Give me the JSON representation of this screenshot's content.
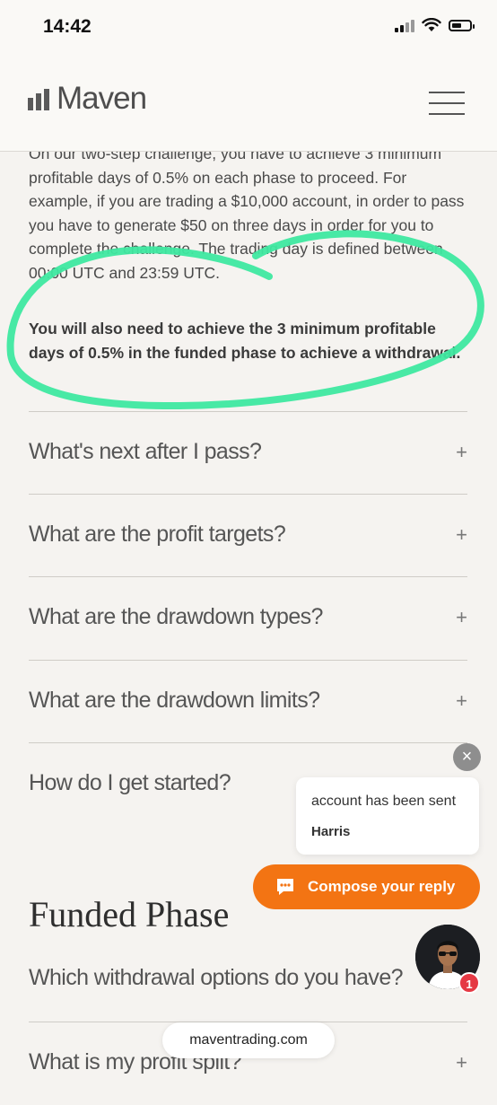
{
  "status_bar": {
    "time": "14:42"
  },
  "brand": {
    "name": "Maven"
  },
  "content": {
    "paragraph": "On our two-step challenge, you have to achieve 3 minimum profitable days of 0.5% on each phase to proceed. For example, if you are trading a $10,000 account, in order to pass you have to generate $50 on three days in order for you to complete the challenge. The trading day is defined between 00:00 UTC and 23:59 UTC.",
    "bold_paragraph": "You will also need to achieve the 3 minimum profitable days of 0.5% in the funded phase to achieve a withdrawal."
  },
  "faq": [
    {
      "question": "What's next after I pass?",
      "icon": "+"
    },
    {
      "question": "What are the profit targets?",
      "icon": "+"
    },
    {
      "question": "What are the drawdown types?",
      "icon": "+"
    },
    {
      "question": "What are the drawdown limits?",
      "icon": "+"
    },
    {
      "question": "How do I get started?",
      "icon": "+"
    }
  ],
  "funded_section": {
    "title": "Funded Phase",
    "faq": [
      {
        "question": "Which withdrawal options do you have?",
        "icon": "+"
      },
      {
        "question": "What is my profit split?",
        "icon": "+"
      }
    ]
  },
  "chat": {
    "close_icon": "×",
    "message": "account has been sent",
    "sender": "Harris",
    "compose_label": "Compose your reply",
    "unread_count": "1"
  },
  "browser": {
    "url": "maventrading.com"
  },
  "colors": {
    "accent": "#f37413",
    "annotation": "#3ee8a0",
    "badge": "#e53944",
    "background": "#f5f3f0"
  }
}
